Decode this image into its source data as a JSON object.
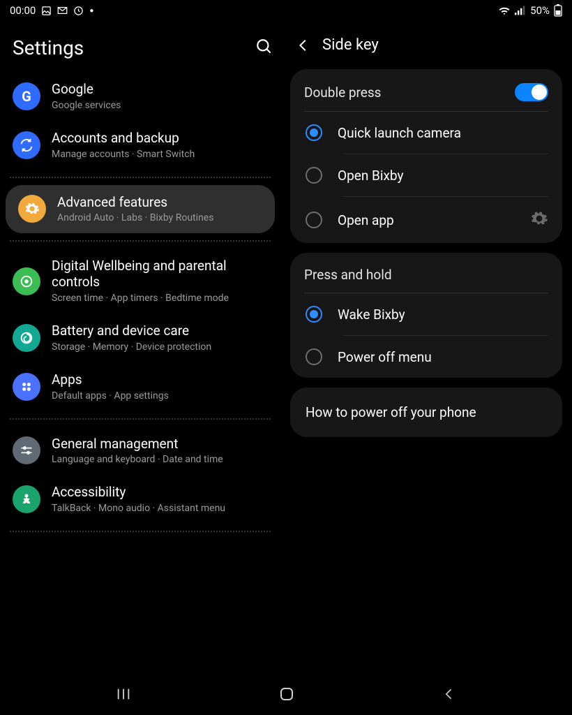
{
  "status": {
    "time": "00:00",
    "battery_text": "50%",
    "icons_left": [
      "picture-icon",
      "gmail-icon",
      "clock-icon",
      "dot-icon"
    ],
    "icons_right": [
      "wifi-icon",
      "signal-icon"
    ]
  },
  "left": {
    "title": "Settings",
    "items": [
      {
        "name": "google",
        "title": "Google",
        "sub": "Google services",
        "icon_bg": "#2f6bff",
        "glyph": "G"
      },
      {
        "name": "accounts",
        "title": "Accounts and backup",
        "sub": "Manage accounts  ·  Smart Switch",
        "icon_bg": "#2f6bff",
        "glyph": "sync"
      },
      {
        "sep": true
      },
      {
        "name": "advanced",
        "title": "Advanced features",
        "sub": "Android Auto  ·  Labs  ·  Bixby Routines",
        "icon_bg": "#f2a93c",
        "glyph": "gear",
        "selected": true
      },
      {
        "sep": true
      },
      {
        "name": "digital-wellbeing",
        "title": "Digital Wellbeing and parental controls",
        "sub": "Screen time  ·  App timers  ·  Bedtime mode",
        "icon_bg": "#3bbd54",
        "glyph": "circle"
      },
      {
        "name": "battery",
        "title": "Battery and device care",
        "sub": "Storage  ·  Memory  ·  Device protection",
        "icon_bg": "#12a994",
        "glyph": "spiral"
      },
      {
        "name": "apps",
        "title": "Apps",
        "sub": "Default apps  ·  App settings",
        "icon_bg": "#4a72ff",
        "glyph": "dots4"
      },
      {
        "sep": true
      },
      {
        "name": "general",
        "title": "General management",
        "sub": "Language and keyboard  ·  Date and time",
        "icon_bg": "#5f6a74",
        "glyph": "sliders"
      },
      {
        "name": "accessibility",
        "title": "Accessibility",
        "sub": "TalkBack  ·  Mono audio  ·  Assistant menu",
        "icon_bg": "#1aa36d",
        "glyph": "person"
      },
      {
        "sep": true
      }
    ]
  },
  "right": {
    "title": "Side key",
    "cards": [
      {
        "name": "double-press",
        "header": "Double press",
        "toggle": true,
        "options": [
          {
            "name": "quick-launch-camera",
            "label": "Quick launch camera",
            "checked": true
          },
          {
            "name": "open-bixby",
            "label": "Open Bixby",
            "checked": false
          },
          {
            "name": "open-app",
            "label": "Open app",
            "checked": false,
            "gear": true
          }
        ]
      },
      {
        "name": "press-hold",
        "header": "Press and hold",
        "options": [
          {
            "name": "wake-bixby",
            "label": "Wake Bixby",
            "checked": true
          },
          {
            "name": "power-off-menu",
            "label": "Power off menu",
            "checked": false
          }
        ]
      }
    ],
    "link": "How to power off your phone"
  },
  "nav": {
    "recent": "recent-button",
    "home": "home-button",
    "back": "back-button"
  }
}
